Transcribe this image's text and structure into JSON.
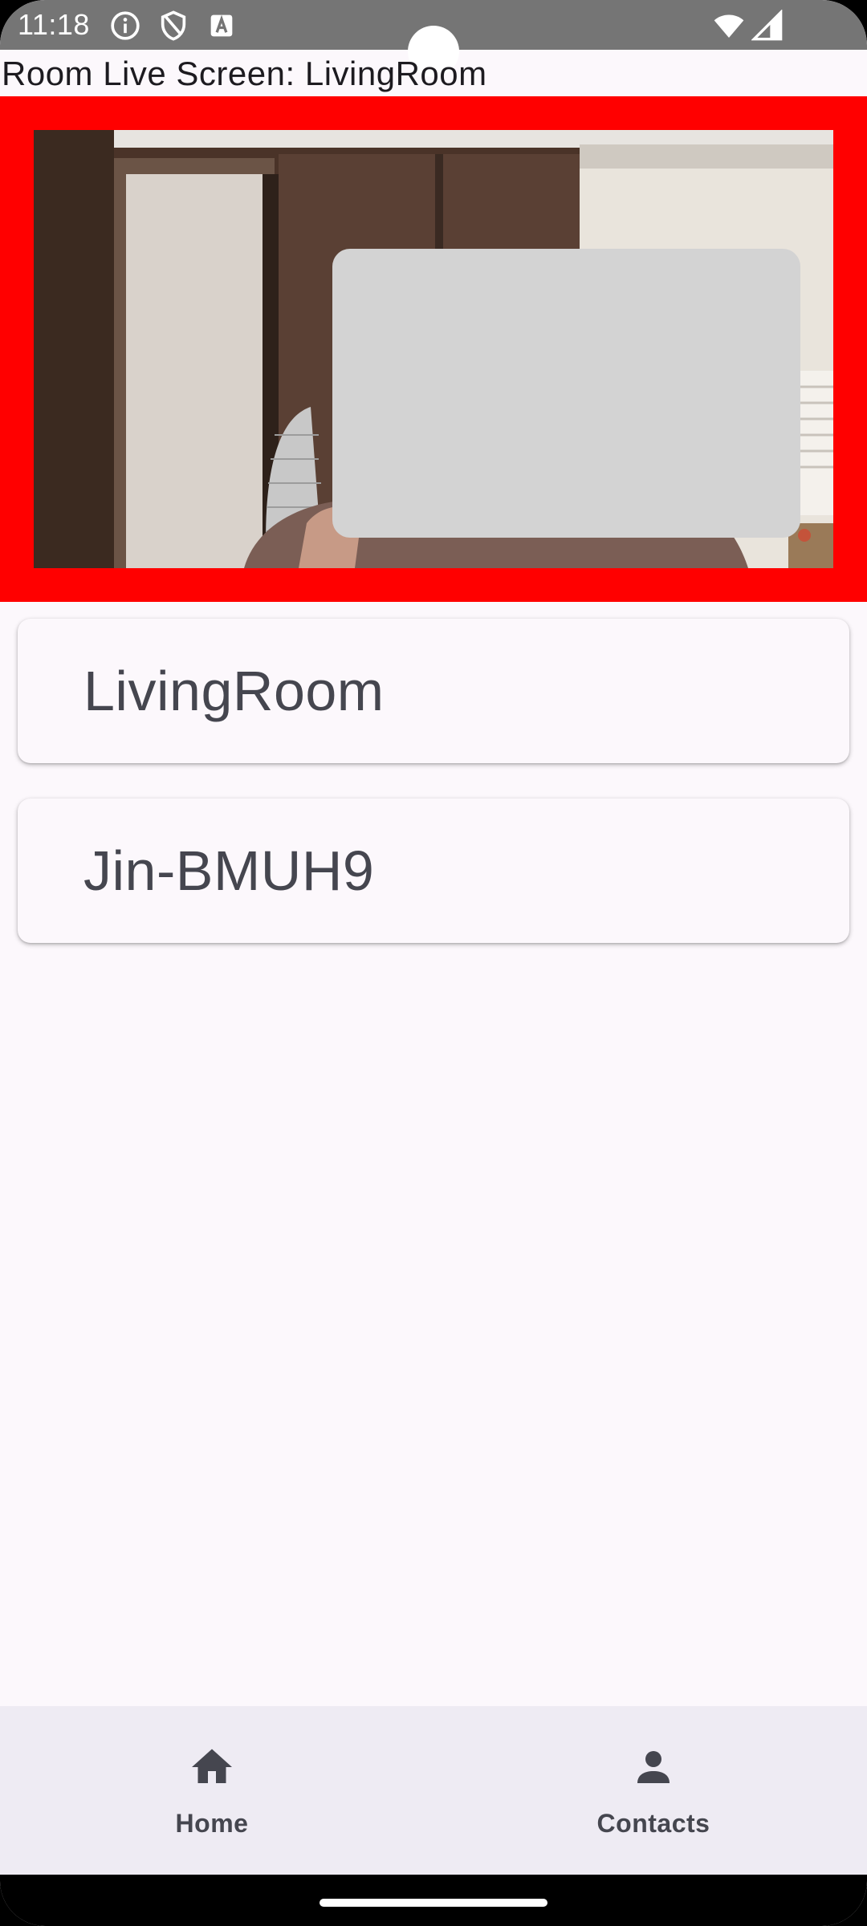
{
  "status_bar": {
    "time": "11:18",
    "left_icons": [
      "info-icon",
      "shield-icon",
      "font-a-icon"
    ],
    "right_icons": [
      "wifi-icon",
      "signal-icon"
    ]
  },
  "screen": {
    "title": "Room Live Screen: LivingRoom"
  },
  "live_view": {
    "border_color": "#ff0000",
    "overlay_color": "#d3d3d3"
  },
  "rooms": [
    {
      "label": "LivingRoom"
    },
    {
      "label": "Jin-BMUH9"
    }
  ],
  "bottom_nav": {
    "items": [
      {
        "label": "Home",
        "icon": "home-icon"
      },
      {
        "label": "Contacts",
        "icon": "person-icon"
      }
    ]
  }
}
